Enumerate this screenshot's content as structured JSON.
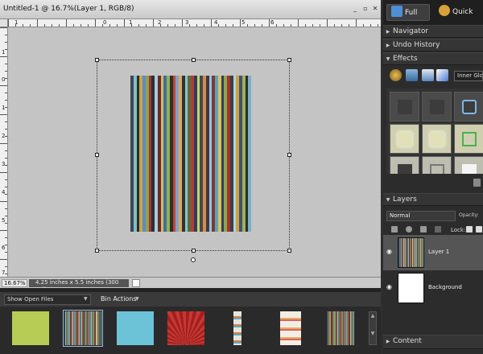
{
  "document": {
    "title": "Untitled-1 @ 16.7%(Layer 1, RGB/8)",
    "controls": {
      "minimize": "_",
      "restore": "▫",
      "close": "✕"
    },
    "ruler_top_numbers": [
      "1",
      "0",
      "1",
      "2",
      "3",
      "4",
      "5",
      "6"
    ],
    "ruler_left_numbers": [
      "1",
      "0",
      "1",
      "2",
      "3",
      "4",
      "5",
      "6",
      "7"
    ],
    "status": {
      "zoom": "16.67%",
      "info": "4.25 inches x 5.5 inches (300 ppi)"
    },
    "stripe_colors": [
      "#3d4757",
      "#7fbfc9",
      "#2f2c29",
      "#c9a64a",
      "#5f8bc4",
      "#8ea34a",
      "#a3342e",
      "#2c2f3a",
      "#a7cfd8",
      "#6c2a2a",
      "#d8b860",
      "#3d6fa5",
      "#94b24e",
      "#2e2e2e",
      "#c44338",
      "#7aa3cf",
      "#e0a85a",
      "#303236",
      "#87c4ce",
      "#5c6d3b",
      "#b53b36",
      "#2c3f5c",
      "#c9d06a",
      "#404a56",
      "#d9894a",
      "#3a3d42",
      "#9dc1df",
      "#7d3a32",
      "#60a0b0",
      "#d6c168",
      "#304055",
      "#8aa84f",
      "#a8322e",
      "#3a3f4a",
      "#b0d3da",
      "#cba14c",
      "#44536c",
      "#9bb35a",
      "#2b2c2f",
      "#7bb0c6"
    ]
  },
  "bin": {
    "select_value": "Show Open Files",
    "actions_label": "Bin Actions",
    "thumbnails": [
      {
        "name": "green-paper",
        "color": "#b7cc54"
      },
      {
        "name": "striped-paper",
        "color": "#8a6a48"
      },
      {
        "name": "blue-paper",
        "color": "#6cc3d8"
      },
      {
        "name": "red-paper",
        "color": "#a41e1f"
      },
      {
        "name": "ribbon-strip",
        "color": "#e8e4dc"
      },
      {
        "name": "ribbon-tabs",
        "color": "#f2eee6"
      },
      {
        "name": "striped-paper-2",
        "color": "#7a7050"
      }
    ]
  },
  "panel": {
    "modes": {
      "full": "Full",
      "quick": "Quick"
    },
    "sections": {
      "navigator": "Navigator",
      "undo_history": "Undo History",
      "effects": "Effects",
      "layers": "Layers",
      "content": "Content"
    },
    "effects_dropdown": "Inner Glows",
    "blend_mode": "Normal",
    "opacity_label": "Opacity:",
    "lock_label": "Lock:",
    "layers": [
      {
        "name": "Layer 1",
        "selected": true
      },
      {
        "name": "Background",
        "selected": false
      }
    ]
  }
}
